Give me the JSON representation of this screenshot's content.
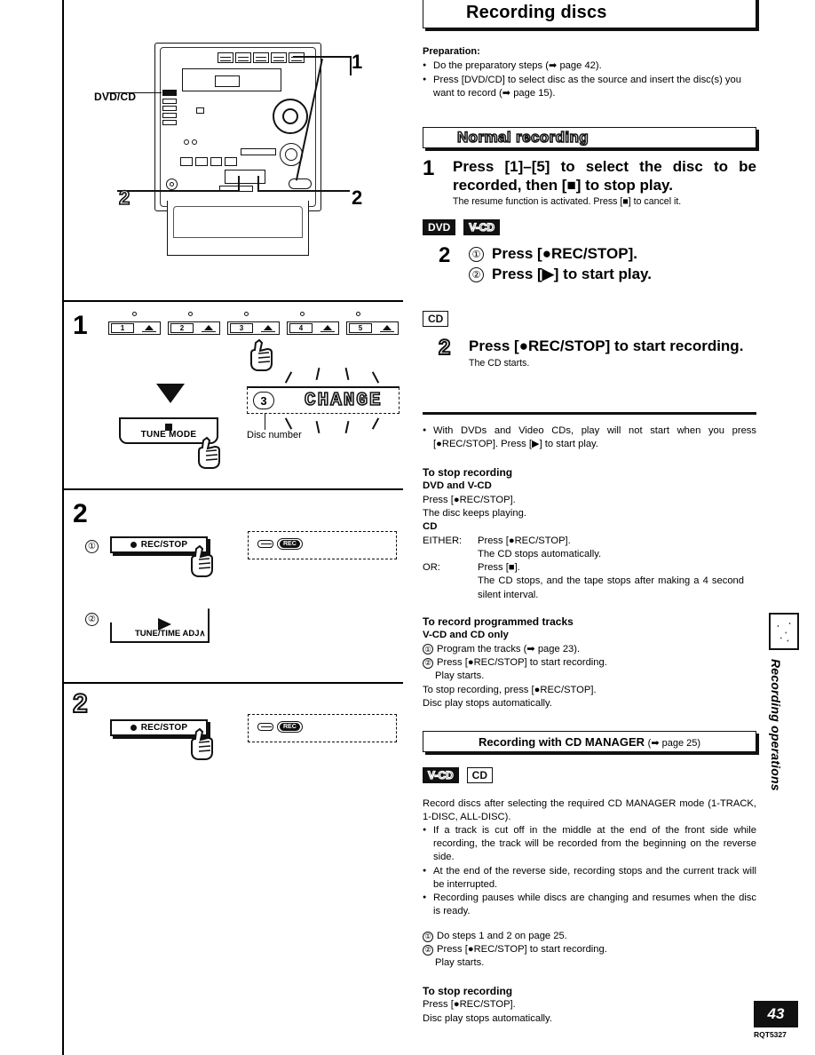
{
  "page": {
    "number": "43",
    "doc_code": "RQT5327",
    "side_tab_label": "Recording operations"
  },
  "title": "Recording discs",
  "preparation": {
    "heading": "Preparation:",
    "bullets": [
      "Do the preparatory steps (➡ page 42).",
      "Press [DVD/CD] to select disc as the source and insert the disc(s) you want to record (➡ page 15)."
    ]
  },
  "normal_recording": {
    "banner": "Normal recording",
    "step1": {
      "number": "1",
      "heading": "Press [1]–[5] to select the disc to be recorded, then [■] to stop play.",
      "sub": "The resume function is activated. Press [■] to cancel it."
    },
    "badges_dvd_vcd": [
      "DVD",
      "V-CD"
    ],
    "step2_dvd": {
      "number": "2",
      "items": [
        {
          "marker": "①",
          "text": "Press [●REC/STOP]."
        },
        {
          "marker": "②",
          "text": "Press [▶] to start play."
        }
      ]
    },
    "badges_cd": [
      "CD"
    ],
    "step2_cd": {
      "number": "2",
      "heading": "Press [●REC/STOP] to start recording.",
      "sub": "The CD starts."
    },
    "note_bullet": "With DVDs and Video CDs, play will not start when you press [●REC/STOP]. Press [▶] to start play.",
    "to_stop_recording": {
      "heading": "To stop recording",
      "dvd_vcd_heading": "DVD and V-CD",
      "dvd_vcd_lines": [
        "Press [●REC/STOP].",
        "The disc keeps playing."
      ],
      "cd_heading": "CD",
      "cd_rows": [
        {
          "label": "EITHER:",
          "lines": [
            "Press [●REC/STOP].",
            "The CD stops automatically."
          ]
        },
        {
          "label": "OR:",
          "lines": [
            "Press [■].",
            "The CD stops, and the tape stops after making a 4 second silent interval."
          ]
        }
      ]
    },
    "programmed": {
      "heading": "To record programmed tracks",
      "subheading": "V-CD and CD only",
      "items": [
        {
          "marker": "①",
          "text": "Program the tracks (➡ page 23)."
        },
        {
          "marker": "②",
          "text": "Press [●REC/STOP] to start recording."
        }
      ],
      "item2_sub": "Play starts.",
      "tail": [
        "To stop recording, press [●REC/STOP].",
        "Disc play stops automatically."
      ]
    }
  },
  "cd_manager": {
    "banner_main": "Recording with CD MANAGER",
    "banner_ref": "(➡ page 25)",
    "badges": [
      "V-CD",
      "CD"
    ],
    "intro": "Record discs after selecting the required CD MANAGER mode (1-TRACK, 1-DISC, ALL-DISC).",
    "bullets": [
      "If a track is cut off in the middle at the end of the front side while recording, the track will be recorded from the beginning on the reverse side.",
      "At the end of the reverse side, recording stops and the current track will be interrupted.",
      "Recording pauses while discs are changing and resumes when the disc is ready."
    ],
    "items": [
      {
        "marker": "①",
        "text": "Do steps 1 and 2 on page 25."
      },
      {
        "marker": "②",
        "text": "Press [●REC/STOP] to start recording."
      }
    ],
    "item2_sub": "Play starts.",
    "to_stop_recording": {
      "heading": "To stop recording",
      "lines": [
        "Press [●REC/STOP].",
        "Disc play stops automatically."
      ]
    }
  },
  "illustrations": {
    "unit": {
      "dvdcd_label": "DVD/CD",
      "callout_top": "1",
      "callout_left": "2",
      "callout_right": "2"
    },
    "step1": {
      "number": "1",
      "disc_buttons": [
        "1",
        "2",
        "3",
        "4",
        "5"
      ],
      "tune_mode_label": "TUNE MODE",
      "display_text": "CHANGE",
      "disc_number_value": "3",
      "disc_number_caption": "Disc number"
    },
    "step2": {
      "number": "2",
      "marker1": "①",
      "marker2": "②",
      "rec_stop_label": "REC/STOP",
      "play_label": "TUNE/TIME ADJ∧",
      "display_rec_label": "REC"
    },
    "step2b": {
      "number": "2",
      "rec_stop_label": "REC/STOP",
      "display_rec_label": "REC"
    }
  }
}
